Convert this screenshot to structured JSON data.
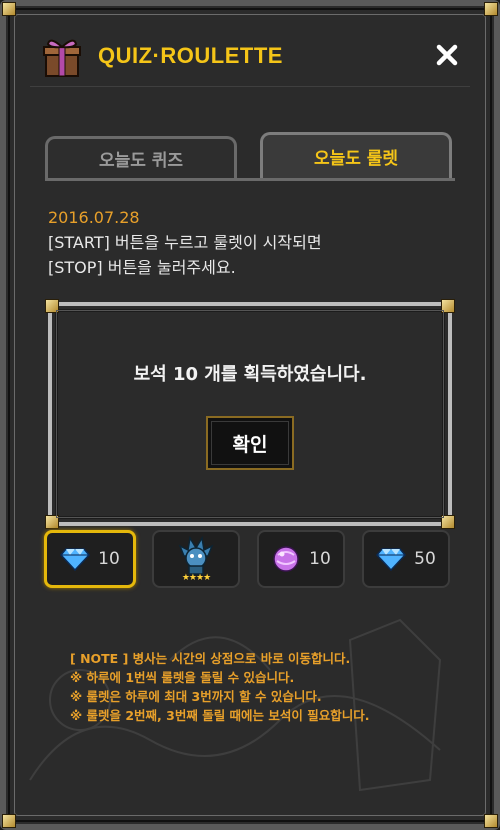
{
  "header": {
    "title": "QUIZ·ROULETTE",
    "close_label": "×"
  },
  "tabs": [
    {
      "label": "오늘도 퀴즈",
      "active": false
    },
    {
      "label": "오늘도 룰렛",
      "active": true
    }
  ],
  "description": {
    "date": "2016.07.28",
    "line1": "[START] 버튼을 누르고 룰렛이 시작되면",
    "line2": "[STOP] 버튼을 눌러주세요."
  },
  "result": {
    "message": "보석 10 개를 획득하였습니다.",
    "confirm_label": "확인"
  },
  "slots": [
    {
      "icon": "diamond-icon",
      "value": "10",
      "selected": true
    },
    {
      "icon": "character-icon",
      "stars": "★★★★",
      "selected": false
    },
    {
      "icon": "purple-gem-icon",
      "value": "10",
      "selected": false
    },
    {
      "icon": "diamond-icon",
      "value": "50",
      "selected": false
    }
  ],
  "notes": {
    "line1": "[ NOTE ] 병사는 시간의 상점으로 바로 이동합니다.",
    "line2": "※ 하루에 1번씩 룰렛을 돌릴 수 있습니다.",
    "line3": "※ 룰렛은 하루에 최대 3번까지 할 수 있습니다.",
    "line4": "※ 룰렛을 2번째, 3번째 돌릴 때에는 보석이 필요합니다."
  },
  "colors": {
    "accent": "#f5c518",
    "note": "#e8a02a",
    "selected_border": "#e5b80b"
  }
}
